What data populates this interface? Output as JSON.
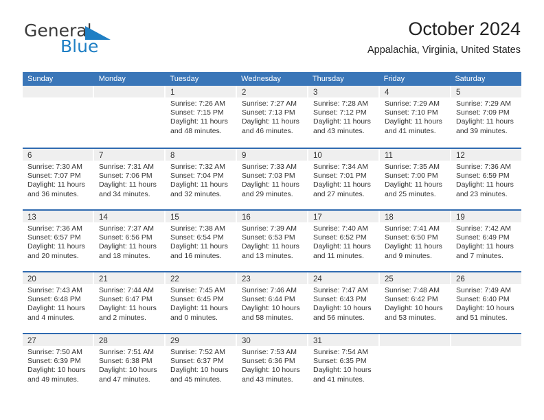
{
  "brand": {
    "name_part1": "General",
    "name_part2": "Blue"
  },
  "header": {
    "title": "October 2024",
    "location": "Appalachia, Virginia, United States"
  },
  "colors": {
    "header_blue": "#3a76b8",
    "row_border_blue": "#2f6ab0",
    "band_gray": "#efefef",
    "brand_blue": "#1f7fc4"
  },
  "weekdays": [
    "Sunday",
    "Monday",
    "Tuesday",
    "Wednesday",
    "Thursday",
    "Friday",
    "Saturday"
  ],
  "weeks": [
    [
      {
        "day": "",
        "empty": true
      },
      {
        "day": "",
        "empty": true
      },
      {
        "day": "1",
        "sunrise": "Sunrise: 7:26 AM",
        "sunset": "Sunset: 7:15 PM",
        "daylight_line1": "Daylight: 11 hours",
        "daylight_line2": "and 48 minutes."
      },
      {
        "day": "2",
        "sunrise": "Sunrise: 7:27 AM",
        "sunset": "Sunset: 7:13 PM",
        "daylight_line1": "Daylight: 11 hours",
        "daylight_line2": "and 46 minutes."
      },
      {
        "day": "3",
        "sunrise": "Sunrise: 7:28 AM",
        "sunset": "Sunset: 7:12 PM",
        "daylight_line1": "Daylight: 11 hours",
        "daylight_line2": "and 43 minutes."
      },
      {
        "day": "4",
        "sunrise": "Sunrise: 7:29 AM",
        "sunset": "Sunset: 7:10 PM",
        "daylight_line1": "Daylight: 11 hours",
        "daylight_line2": "and 41 minutes."
      },
      {
        "day": "5",
        "sunrise": "Sunrise: 7:29 AM",
        "sunset": "Sunset: 7:09 PM",
        "daylight_line1": "Daylight: 11 hours",
        "daylight_line2": "and 39 minutes."
      }
    ],
    [
      {
        "day": "6",
        "sunrise": "Sunrise: 7:30 AM",
        "sunset": "Sunset: 7:07 PM",
        "daylight_line1": "Daylight: 11 hours",
        "daylight_line2": "and 36 minutes."
      },
      {
        "day": "7",
        "sunrise": "Sunrise: 7:31 AM",
        "sunset": "Sunset: 7:06 PM",
        "daylight_line1": "Daylight: 11 hours",
        "daylight_line2": "and 34 minutes."
      },
      {
        "day": "8",
        "sunrise": "Sunrise: 7:32 AM",
        "sunset": "Sunset: 7:04 PM",
        "daylight_line1": "Daylight: 11 hours",
        "daylight_line2": "and 32 minutes."
      },
      {
        "day": "9",
        "sunrise": "Sunrise: 7:33 AM",
        "sunset": "Sunset: 7:03 PM",
        "daylight_line1": "Daylight: 11 hours",
        "daylight_line2": "and 29 minutes."
      },
      {
        "day": "10",
        "sunrise": "Sunrise: 7:34 AM",
        "sunset": "Sunset: 7:01 PM",
        "daylight_line1": "Daylight: 11 hours",
        "daylight_line2": "and 27 minutes."
      },
      {
        "day": "11",
        "sunrise": "Sunrise: 7:35 AM",
        "sunset": "Sunset: 7:00 PM",
        "daylight_line1": "Daylight: 11 hours",
        "daylight_line2": "and 25 minutes."
      },
      {
        "day": "12",
        "sunrise": "Sunrise: 7:36 AM",
        "sunset": "Sunset: 6:59 PM",
        "daylight_line1": "Daylight: 11 hours",
        "daylight_line2": "and 23 minutes."
      }
    ],
    [
      {
        "day": "13",
        "sunrise": "Sunrise: 7:36 AM",
        "sunset": "Sunset: 6:57 PM",
        "daylight_line1": "Daylight: 11 hours",
        "daylight_line2": "and 20 minutes."
      },
      {
        "day": "14",
        "sunrise": "Sunrise: 7:37 AM",
        "sunset": "Sunset: 6:56 PM",
        "daylight_line1": "Daylight: 11 hours",
        "daylight_line2": "and 18 minutes."
      },
      {
        "day": "15",
        "sunrise": "Sunrise: 7:38 AM",
        "sunset": "Sunset: 6:54 PM",
        "daylight_line1": "Daylight: 11 hours",
        "daylight_line2": "and 16 minutes."
      },
      {
        "day": "16",
        "sunrise": "Sunrise: 7:39 AM",
        "sunset": "Sunset: 6:53 PM",
        "daylight_line1": "Daylight: 11 hours",
        "daylight_line2": "and 13 minutes."
      },
      {
        "day": "17",
        "sunrise": "Sunrise: 7:40 AM",
        "sunset": "Sunset: 6:52 PM",
        "daylight_line1": "Daylight: 11 hours",
        "daylight_line2": "and 11 minutes."
      },
      {
        "day": "18",
        "sunrise": "Sunrise: 7:41 AM",
        "sunset": "Sunset: 6:50 PM",
        "daylight_line1": "Daylight: 11 hours",
        "daylight_line2": "and 9 minutes."
      },
      {
        "day": "19",
        "sunrise": "Sunrise: 7:42 AM",
        "sunset": "Sunset: 6:49 PM",
        "daylight_line1": "Daylight: 11 hours",
        "daylight_line2": "and 7 minutes."
      }
    ],
    [
      {
        "day": "20",
        "sunrise": "Sunrise: 7:43 AM",
        "sunset": "Sunset: 6:48 PM",
        "daylight_line1": "Daylight: 11 hours",
        "daylight_line2": "and 4 minutes."
      },
      {
        "day": "21",
        "sunrise": "Sunrise: 7:44 AM",
        "sunset": "Sunset: 6:47 PM",
        "daylight_line1": "Daylight: 11 hours",
        "daylight_line2": "and 2 minutes."
      },
      {
        "day": "22",
        "sunrise": "Sunrise: 7:45 AM",
        "sunset": "Sunset: 6:45 PM",
        "daylight_line1": "Daylight: 11 hours",
        "daylight_line2": "and 0 minutes."
      },
      {
        "day": "23",
        "sunrise": "Sunrise: 7:46 AM",
        "sunset": "Sunset: 6:44 PM",
        "daylight_line1": "Daylight: 10 hours",
        "daylight_line2": "and 58 minutes."
      },
      {
        "day": "24",
        "sunrise": "Sunrise: 7:47 AM",
        "sunset": "Sunset: 6:43 PM",
        "daylight_line1": "Daylight: 10 hours",
        "daylight_line2": "and 56 minutes."
      },
      {
        "day": "25",
        "sunrise": "Sunrise: 7:48 AM",
        "sunset": "Sunset: 6:42 PM",
        "daylight_line1": "Daylight: 10 hours",
        "daylight_line2": "and 53 minutes."
      },
      {
        "day": "26",
        "sunrise": "Sunrise: 7:49 AM",
        "sunset": "Sunset: 6:40 PM",
        "daylight_line1": "Daylight: 10 hours",
        "daylight_line2": "and 51 minutes."
      }
    ],
    [
      {
        "day": "27",
        "sunrise": "Sunrise: 7:50 AM",
        "sunset": "Sunset: 6:39 PM",
        "daylight_line1": "Daylight: 10 hours",
        "daylight_line2": "and 49 minutes."
      },
      {
        "day": "28",
        "sunrise": "Sunrise: 7:51 AM",
        "sunset": "Sunset: 6:38 PM",
        "daylight_line1": "Daylight: 10 hours",
        "daylight_line2": "and 47 minutes."
      },
      {
        "day": "29",
        "sunrise": "Sunrise: 7:52 AM",
        "sunset": "Sunset: 6:37 PM",
        "daylight_line1": "Daylight: 10 hours",
        "daylight_line2": "and 45 minutes."
      },
      {
        "day": "30",
        "sunrise": "Sunrise: 7:53 AM",
        "sunset": "Sunset: 6:36 PM",
        "daylight_line1": "Daylight: 10 hours",
        "daylight_line2": "and 43 minutes."
      },
      {
        "day": "31",
        "sunrise": "Sunrise: 7:54 AM",
        "sunset": "Sunset: 6:35 PM",
        "daylight_line1": "Daylight: 10 hours",
        "daylight_line2": "and 41 minutes."
      },
      {
        "day": "",
        "empty": true
      },
      {
        "day": "",
        "empty": true
      }
    ]
  ]
}
